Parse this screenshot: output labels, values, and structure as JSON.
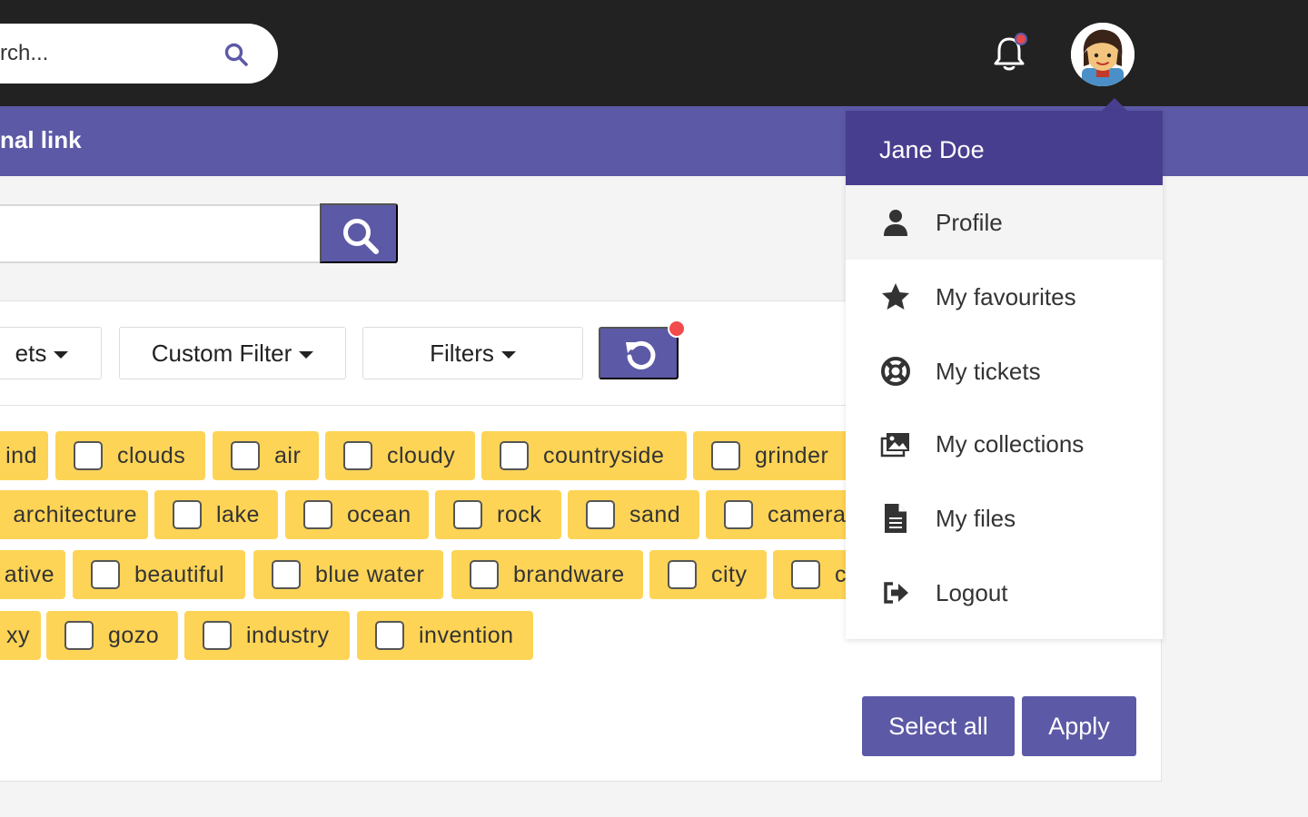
{
  "header": {
    "search_placeholder": "rch...",
    "user_name": "Jane Doe"
  },
  "navbar": {
    "link_label": "nal link"
  },
  "search": {
    "placeholder": ""
  },
  "filters": {
    "buttons": [
      "ets",
      "Custom Filter",
      "Filters"
    ]
  },
  "tags": {
    "row1": [
      "ind",
      "clouds",
      "air",
      "cloudy",
      "countryside",
      "grinder"
    ],
    "row2": [
      "architecture",
      "lake",
      "ocean",
      "rock",
      "sand",
      "camera"
    ],
    "row3": [
      "ative",
      "beautiful",
      "blue water",
      "brandware",
      "city",
      "c"
    ],
    "row4": [
      "xy",
      "gozo",
      "industry",
      "invention"
    ]
  },
  "actions": {
    "select_all": "Select all",
    "apply": "Apply"
  },
  "menu": {
    "header": "Jane Doe",
    "items": [
      {
        "label": "Profile",
        "icon": "user-icon"
      },
      {
        "label": "My favourites",
        "icon": "star-icon"
      },
      {
        "label": "My tickets",
        "icon": "lifebuoy-icon"
      },
      {
        "label": "My collections",
        "icon": "images-icon"
      },
      {
        "label": "My files",
        "icon": "file-icon"
      },
      {
        "label": "Logout",
        "icon": "logout-icon"
      }
    ]
  },
  "colors": {
    "topbar": "#222222",
    "brand": "#5c59a6",
    "menu_header": "#483e8f",
    "tag": "#fdd456",
    "notification": "#e6494c"
  }
}
